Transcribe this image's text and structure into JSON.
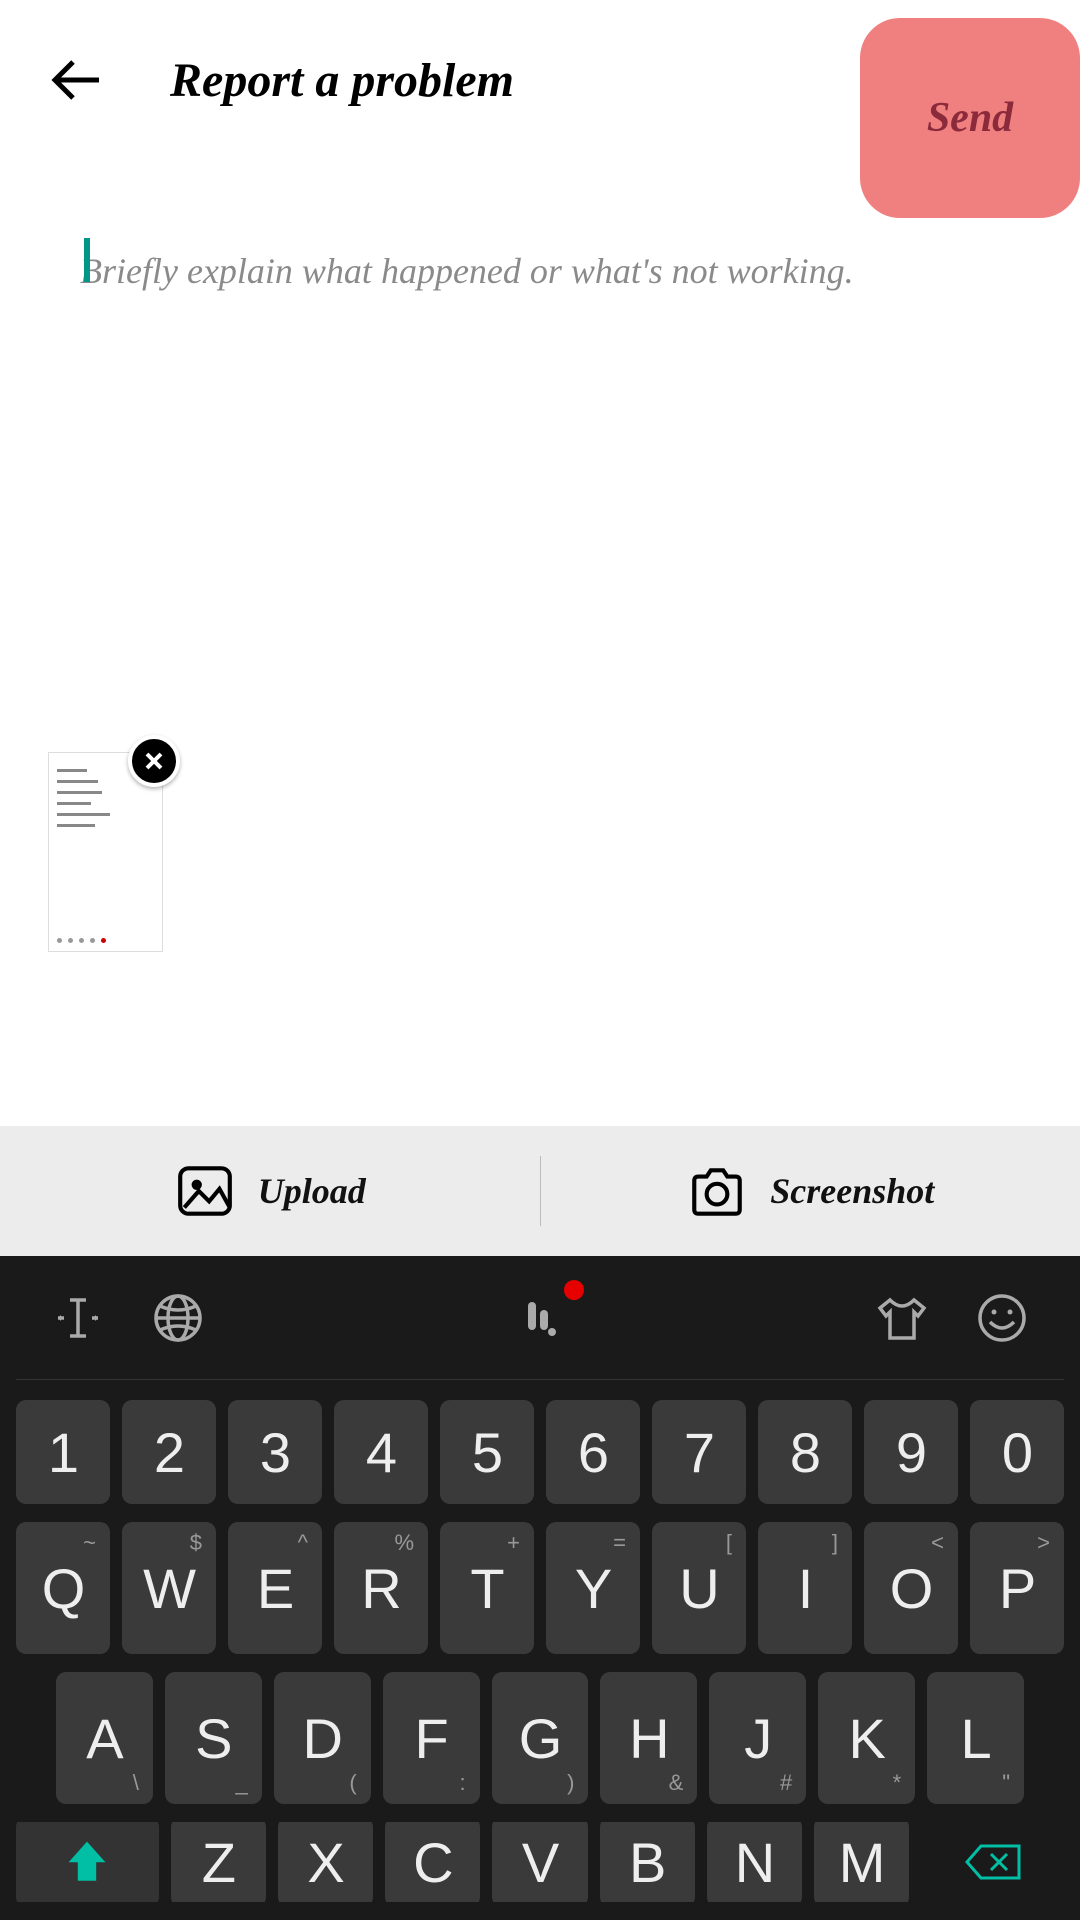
{
  "header": {
    "title": "Report a problem",
    "send_label": "Send"
  },
  "textarea": {
    "placeholder": "Briefly explain what happened or what's not working.",
    "value": ""
  },
  "actions": {
    "upload_label": "Upload",
    "screenshot_label": "Screenshot"
  },
  "keyboard": {
    "row_numbers": [
      "1",
      "2",
      "3",
      "4",
      "5",
      "6",
      "7",
      "8",
      "9",
      "0"
    ],
    "row_qwerty": [
      {
        "main": "Q",
        "alt_top": "~"
      },
      {
        "main": "W",
        "alt_top": "$"
      },
      {
        "main": "E",
        "alt_top": "^"
      },
      {
        "main": "R",
        "alt_top": "%"
      },
      {
        "main": "T",
        "alt_top": "+"
      },
      {
        "main": "Y",
        "alt_top": "="
      },
      {
        "main": "U",
        "alt_top": "["
      },
      {
        "main": "I",
        "alt_top": "]"
      },
      {
        "main": "O",
        "alt_top": "<"
      },
      {
        "main": "P",
        "alt_top": ">"
      }
    ],
    "row_asdf": [
      {
        "main": "A",
        "alt_bot": "\\"
      },
      {
        "main": "S",
        "alt_bot": "_"
      },
      {
        "main": "D",
        "alt_bot": "("
      },
      {
        "main": "F",
        "alt_bot": ":"
      },
      {
        "main": "G",
        "alt_bot": ")"
      },
      {
        "main": "H",
        "alt_bot": "&"
      },
      {
        "main": "J",
        "alt_bot": "#"
      },
      {
        "main": "K",
        "alt_bot": "*"
      },
      {
        "main": "L",
        "alt_bot": "\""
      }
    ],
    "row_zxcv": [
      "Z",
      "X",
      "C",
      "V",
      "B",
      "N",
      "M"
    ]
  }
}
